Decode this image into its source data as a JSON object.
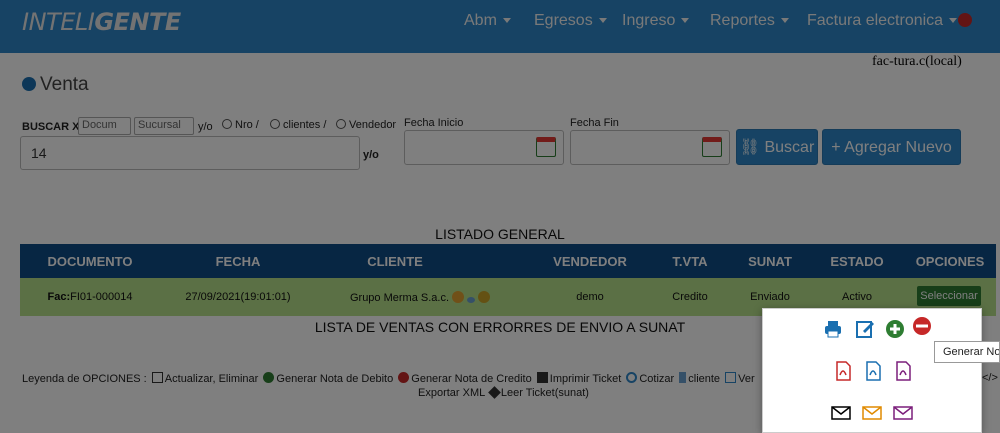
{
  "brand": {
    "part1": "INTELI",
    "part2": "GENTE"
  },
  "nav": [
    "Abm",
    "Egresos",
    "Ingreso",
    "Reportes",
    "Factura electronica"
  ],
  "host_text": "fac-tura.c(local)",
  "page_title": "Venta",
  "search": {
    "label": "BUSCAR X",
    "select1": "Docum",
    "select2": "Sucursal",
    "yo": "y/o",
    "radios": [
      "Nro /",
      "clientes /",
      "Vendedor"
    ],
    "value": "14",
    "yo2": "y/o"
  },
  "fecha_inicio": {
    "label": "Fecha Inicio",
    "value": ""
  },
  "fecha_fin": {
    "label": "Fecha Fin",
    "value": ""
  },
  "buttons": {
    "buscar": "Buscar",
    "agregar": "Agregar Nuevo"
  },
  "listado_title": "LISTADO GENERAL",
  "table": {
    "headers": [
      "DOCUMENTO",
      "FECHA",
      "CLIENTE",
      "VENDEDOR",
      "T.VTA",
      "SUNAT",
      "ESTADO",
      "OPCIONES"
    ],
    "row": {
      "doc_prefix": "Fac:",
      "doc": "FI01-000014",
      "fecha": "27/09/2021(19:01:01)",
      "cliente": "Grupo Merma S.a.c.",
      "vendedor": "demo",
      "tvta": "Credito",
      "sunat": "Enviado",
      "estado": "Activo",
      "opcion": "Seleccionar"
    }
  },
  "errores_title": "LISTA DE VENTAS CON ERRORRES DE ENVIO A SUNAT",
  "legend": {
    "label": "Leyenda de OPCIONES :",
    "items": [
      "Actualizar, Eliminar",
      "Generar Nota de Debito",
      "Generar Nota de Credito",
      "Imprimir Ticket",
      "Cotizar",
      "cliente",
      "Ver"
    ],
    "line2": [
      "Exportar XML",
      "Leer Ticket(sunat)"
    ],
    "tail": "</>"
  },
  "tooltip": "Generar Nota",
  "colors": {
    "navbar": "#2e87c8",
    "table_header": "#0f4d87",
    "row": "#b7e08a",
    "button": "#2e87c8"
  }
}
